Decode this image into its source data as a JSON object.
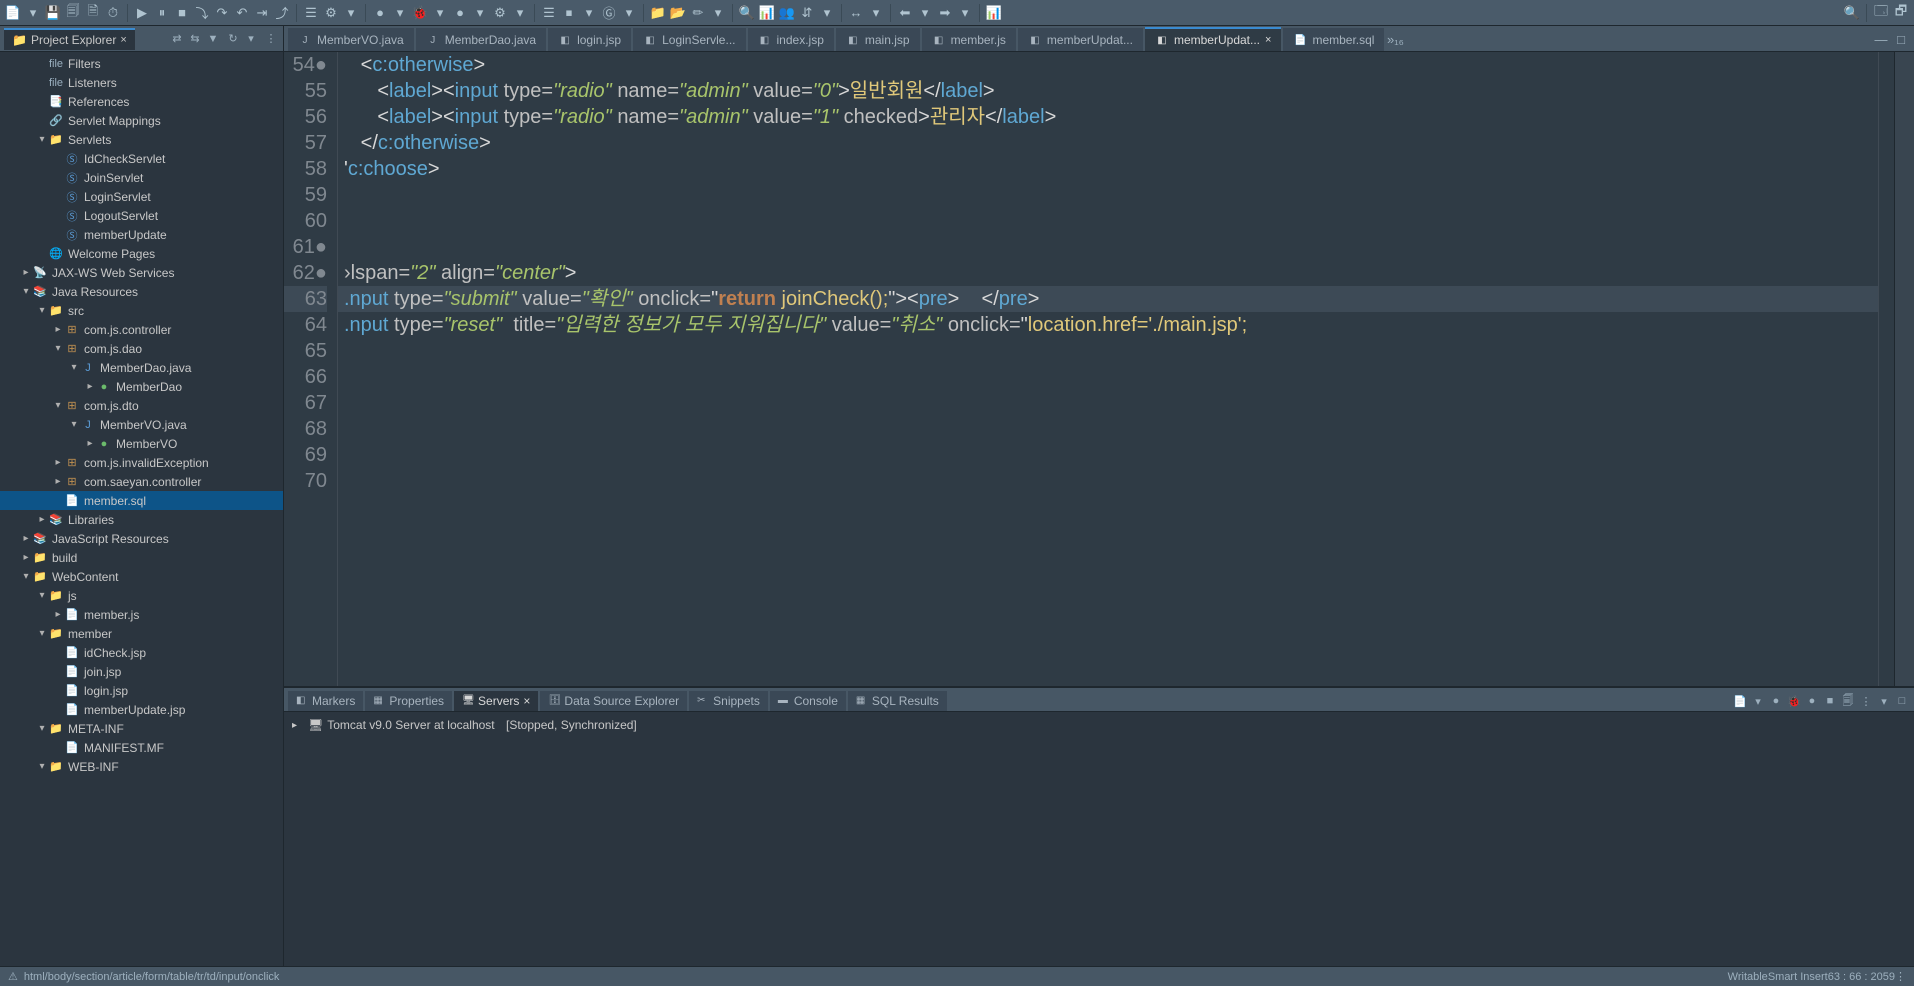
{
  "toolbarIcons": [
    "📄",
    "▾",
    "💾",
    "🗐",
    "🗎",
    "⏱",
    "│",
    "▶",
    "⏸",
    "■",
    "⤵",
    "↷",
    "↶",
    "⇥",
    "⤴",
    "│",
    "☰",
    "⚙",
    "▾",
    "│",
    "●",
    "▾",
    "🐞",
    "▾",
    "●",
    "▾",
    "⚙",
    "▾",
    "│",
    "☰",
    "⏹",
    "▾",
    "Ⓖ",
    "▾",
    "│",
    "📁",
    "📂",
    "✏",
    "▾",
    "│",
    "🔍",
    "📊",
    "👥",
    "⇵",
    "▾",
    "│",
    "↔",
    "▾",
    "│",
    "⬅",
    "▾",
    "➡",
    "▾",
    "│",
    "📊"
  ],
  "toolbarRight": [
    "🔍",
    "│",
    "🗔",
    "🗗"
  ],
  "explorer": {
    "title": "Project Explorer",
    "icons": [
      "⇄",
      "⇆",
      "▼",
      "│",
      "↻",
      "▾",
      "│",
      "⋮"
    ],
    "tree": [
      {
        "d": 2,
        "tw": "",
        "i": "file",
        "c": "file",
        "t": "Filters"
      },
      {
        "d": 2,
        "tw": "",
        "i": "file",
        "c": "file",
        "t": "Listeners"
      },
      {
        "d": 2,
        "tw": "",
        "i": "📑",
        "c": "file",
        "t": "References"
      },
      {
        "d": 2,
        "tw": "",
        "i": "🔗",
        "c": "file",
        "t": "Servlet Mappings"
      },
      {
        "d": 2,
        "tw": "▾",
        "i": "📁",
        "c": "folder",
        "t": "Servlets"
      },
      {
        "d": 3,
        "tw": "",
        "i": "Ⓢ",
        "c": "java",
        "t": "IdCheckServlet"
      },
      {
        "d": 3,
        "tw": "",
        "i": "Ⓢ",
        "c": "java",
        "t": "JoinServlet"
      },
      {
        "d": 3,
        "tw": "",
        "i": "Ⓢ",
        "c": "java",
        "t": "LoginServlet"
      },
      {
        "d": 3,
        "tw": "",
        "i": "Ⓢ",
        "c": "java",
        "t": "LogoutServlet"
      },
      {
        "d": 3,
        "tw": "",
        "i": "Ⓢ",
        "c": "java",
        "t": "memberUpdate"
      },
      {
        "d": 2,
        "tw": "",
        "i": "🌐",
        "c": "file",
        "t": "Welcome Pages"
      },
      {
        "d": 1,
        "tw": "▸",
        "i": "📡",
        "c": "file",
        "t": "JAX-WS Web Services"
      },
      {
        "d": 1,
        "tw": "▾",
        "i": "📚",
        "c": "folder",
        "t": "Java Resources"
      },
      {
        "d": 2,
        "tw": "▾",
        "i": "📁",
        "c": "folder",
        "t": "src"
      },
      {
        "d": 3,
        "tw": "▸",
        "i": "⊞",
        "c": "pkg",
        "t": "com.js.controller"
      },
      {
        "d": 3,
        "tw": "▾",
        "i": "⊞",
        "c": "pkg",
        "t": "com.js.dao"
      },
      {
        "d": 4,
        "tw": "▾",
        "i": "J",
        "c": "java",
        "t": "MemberDao.java"
      },
      {
        "d": 5,
        "tw": "▸",
        "i": "●",
        "c": "class",
        "t": "MemberDao"
      },
      {
        "d": 3,
        "tw": "▾",
        "i": "⊞",
        "c": "pkg",
        "t": "com.js.dto"
      },
      {
        "d": 4,
        "tw": "▾",
        "i": "J",
        "c": "java",
        "t": "MemberVO.java"
      },
      {
        "d": 5,
        "tw": "▸",
        "i": "●",
        "c": "class",
        "t": "MemberVO"
      },
      {
        "d": 3,
        "tw": "▸",
        "i": "⊞",
        "c": "pkg",
        "t": "com.js.invalidException"
      },
      {
        "d": 3,
        "tw": "▸",
        "i": "⊞",
        "c": "pkg",
        "t": "com.saeyan.controller"
      },
      {
        "d": 3,
        "tw": "",
        "i": "📄",
        "c": "file",
        "t": "member.sql",
        "sel": true
      },
      {
        "d": 2,
        "tw": "▸",
        "i": "📚",
        "c": "folder",
        "t": "Libraries"
      },
      {
        "d": 1,
        "tw": "▸",
        "i": "📚",
        "c": "folder",
        "t": "JavaScript Resources"
      },
      {
        "d": 1,
        "tw": "▸",
        "i": "📁",
        "c": "folder",
        "t": "build"
      },
      {
        "d": 1,
        "tw": "▾",
        "i": "📁",
        "c": "folder",
        "t": "WebContent"
      },
      {
        "d": 2,
        "tw": "▾",
        "i": "📁",
        "c": "folder",
        "t": "js"
      },
      {
        "d": 3,
        "tw": "▸",
        "i": "📄",
        "c": "file",
        "t": "member.js"
      },
      {
        "d": 2,
        "tw": "▾",
        "i": "📁",
        "c": "folder",
        "t": "member"
      },
      {
        "d": 3,
        "tw": "",
        "i": "📄",
        "c": "file",
        "t": "idCheck.jsp"
      },
      {
        "d": 3,
        "tw": "",
        "i": "📄",
        "c": "file",
        "t": "join.jsp"
      },
      {
        "d": 3,
        "tw": "",
        "i": "📄",
        "c": "file",
        "t": "login.jsp"
      },
      {
        "d": 3,
        "tw": "",
        "i": "📄",
        "c": "file",
        "t": "memberUpdate.jsp"
      },
      {
        "d": 2,
        "tw": "▾",
        "i": "📁",
        "c": "folder",
        "t": "META-INF"
      },
      {
        "d": 3,
        "tw": "",
        "i": "📄",
        "c": "file",
        "t": "MANIFEST.MF"
      },
      {
        "d": 2,
        "tw": "▾",
        "i": "📁",
        "c": "folder",
        "t": "WEB-INF"
      }
    ]
  },
  "editorTabs": [
    {
      "i": "J",
      "t": "MemberVO.java"
    },
    {
      "i": "J",
      "t": "MemberDao.java"
    },
    {
      "i": "◧",
      "t": "login.jsp"
    },
    {
      "i": "◧",
      "t": "LoginServle..."
    },
    {
      "i": "◧",
      "t": "index.jsp"
    },
    {
      "i": "◧",
      "t": "main.jsp"
    },
    {
      "i": "◧",
      "t": "member.js"
    },
    {
      "i": "◧",
      "t": "memberUpdat..."
    },
    {
      "i": "◧",
      "t": "memberUpdat...",
      "active": true,
      "close": true
    },
    {
      "i": "📄",
      "t": "member.sql"
    }
  ],
  "moreTabs": "»₁₆",
  "code": {
    "start": 54,
    "hl": 63,
    "lines": [
      {
        "fold": "●",
        "html": "   <span class='tk-br'>&lt;</span><span class='tk-tag'>c:otherwise</span><span class='tk-br'>&gt;</span>"
      },
      {
        "html": "      <span class='tk-br'>&lt;</span><span class='tk-tag'>label</span><span class='tk-br'>&gt;&lt;</span><span class='tk-tag'>input</span> <span class='tk-attr'>type=</span><span class='tk-str'>\"radio\"</span> <span class='tk-attr'>name=</span><span class='tk-str'>\"admin\"</span> <span class='tk-attr'>value=</span><span class='tk-str'>\"0\"</span><span class='tk-br'>&gt;</span><span class='tk-txt'>일반회원</span><span class='tk-br'>&lt;/</span><span class='tk-tag'>label</span><span class='tk-br'>&gt;</span>"
      },
      {
        "html": "      <span class='tk-br'>&lt;</span><span class='tk-tag'>label</span><span class='tk-br'>&gt;&lt;</span><span class='tk-tag'>input</span> <span class='tk-attr'>type=</span><span class='tk-str'>\"radio\"</span> <span class='tk-attr'>name=</span><span class='tk-str'>\"admin\"</span> <span class='tk-attr'>value=</span><span class='tk-str'>\"1\"</span> <span class='tk-attr'>checked</span><span class='tk-br'>&gt;</span><span class='tk-txt'>관리자</span><span class='tk-br'>&lt;/</span><span class='tk-tag'>label</span><span class='tk-br'>&gt;</span>"
      },
      {
        "html": "   <span class='tk-br'>&lt;/</span><span class='tk-tag'>c:otherwise</span><span class='tk-br'>&gt;</span>"
      },
      {
        "html": "<span class='tk-br'>'</span><span class='tk-tag'>c:choose</span><span class='tk-br'>&gt;</span>"
      },
      {
        "html": ""
      },
      {
        "html": ""
      },
      {
        "fold": "●",
        "html": ""
      },
      {
        "fold": "●",
        "html": "<span class='tk-attr'>›lspan=</span><span class='tk-str'>\"2\"</span> <span class='tk-attr'>align=</span><span class='tk-str'>\"center\"</span><span class='tk-br'>&gt;</span>"
      },
      {
        "html": "<span class='tk-tag'>.nput</span> <span class='tk-attr'>type=</span><span class='tk-str'>\"submit\"</span> <span class='tk-attr'>value=</span><span class='tk-str'>\"확인\"</span> <span class='tk-attr'>onclick=</span><span class='tk-br'>\"</span><span class='tk-kw'>return</span> <span class='tk-js'>joinCheck();</span><span class='tk-br'>\"&gt;&lt;</span><span class='tk-tag'>pre</span><span class='tk-br'>&gt;</span>    <span class='tk-br'>&lt;/</span><span class='tk-tag'>pre</span><span class='tk-br'>&gt;</span>"
      },
      {
        "html": "<span class='tk-tag'>.nput</span> <span class='tk-attr'>type=</span><span class='tk-str'>\"reset\"</span>  <span class='tk-attr'>title=</span><span class='tk-str'>\"입력한 정보가 모두 지워집니다\"</span> <span class='tk-attr'>value=</span><span class='tk-str'>\"취소\"</span> <span class='tk-attr'>onclick=</span><span class='tk-br'>\"</span><span class='tk-js'>location.href='./main.jsp';</span>"
      },
      {
        "html": ""
      },
      {
        "html": ""
      },
      {
        "html": ""
      },
      {
        "html": ""
      },
      {
        "html": ""
      },
      {
        "html": ""
      }
    ]
  },
  "bottomTabs": [
    {
      "i": "◧",
      "t": "Markers"
    },
    {
      "i": "▦",
      "t": "Properties"
    },
    {
      "i": "🖥",
      "t": "Servers",
      "active": true,
      "close": true
    },
    {
      "i": "🗄",
      "t": "Data Source Explorer"
    },
    {
      "i": "✂",
      "t": "Snippets"
    },
    {
      "i": "▬",
      "t": "Console"
    },
    {
      "i": "▦",
      "t": "SQL Results"
    }
  ],
  "bottomTools": [
    "📄",
    "▾",
    "●",
    "🐞",
    "●",
    "■",
    "🗐",
    "⋮",
    "▾",
    "□"
  ],
  "server": {
    "tw": "▸",
    "i": "🖥",
    "name": "Tomcat v9.0 Server at localhost",
    "status": "[Stopped, Synchronized]"
  },
  "breadcrumb": "html/body/section/article/form/table/tr/td/input/onclick",
  "status": {
    "writable": "Writable",
    "insert": "Smart Insert",
    "pos": "63 : 66 : 2059"
  }
}
